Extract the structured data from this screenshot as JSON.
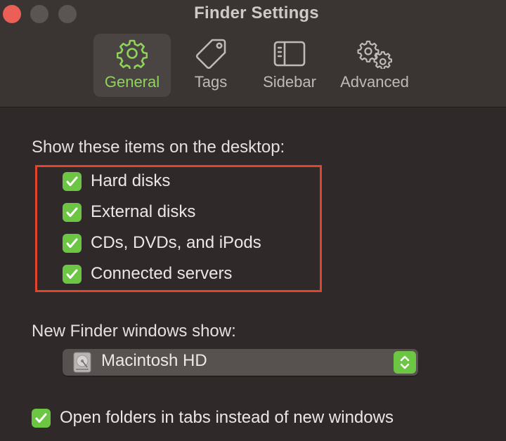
{
  "window": {
    "title": "Finder Settings"
  },
  "tabs": [
    {
      "label": "General",
      "icon": "gear-icon",
      "active": true
    },
    {
      "label": "Tags",
      "icon": "tag-icon",
      "active": false
    },
    {
      "label": "Sidebar",
      "icon": "sidebar-icon",
      "active": false
    },
    {
      "label": "Advanced",
      "icon": "gears-icon",
      "active": false
    }
  ],
  "desktop_items": {
    "heading": "Show these items on the desktop:",
    "items": [
      {
        "label": "Hard disks",
        "checked": true
      },
      {
        "label": "External disks",
        "checked": true
      },
      {
        "label": "CDs, DVDs, and iPods",
        "checked": true
      },
      {
        "label": "Connected servers",
        "checked": true
      }
    ]
  },
  "new_window": {
    "heading": "New Finder windows show:",
    "selected": "Macintosh HD",
    "icon": "hard-disk-icon"
  },
  "open_in_tabs": {
    "label": "Open folders in tabs instead of new windows",
    "checked": true
  },
  "colors": {
    "accent": "#6cc644",
    "accent_text": "#8fd35a",
    "highlight": "#e0442c",
    "background": "#2f2a29",
    "toolbar": "#3a3433"
  }
}
